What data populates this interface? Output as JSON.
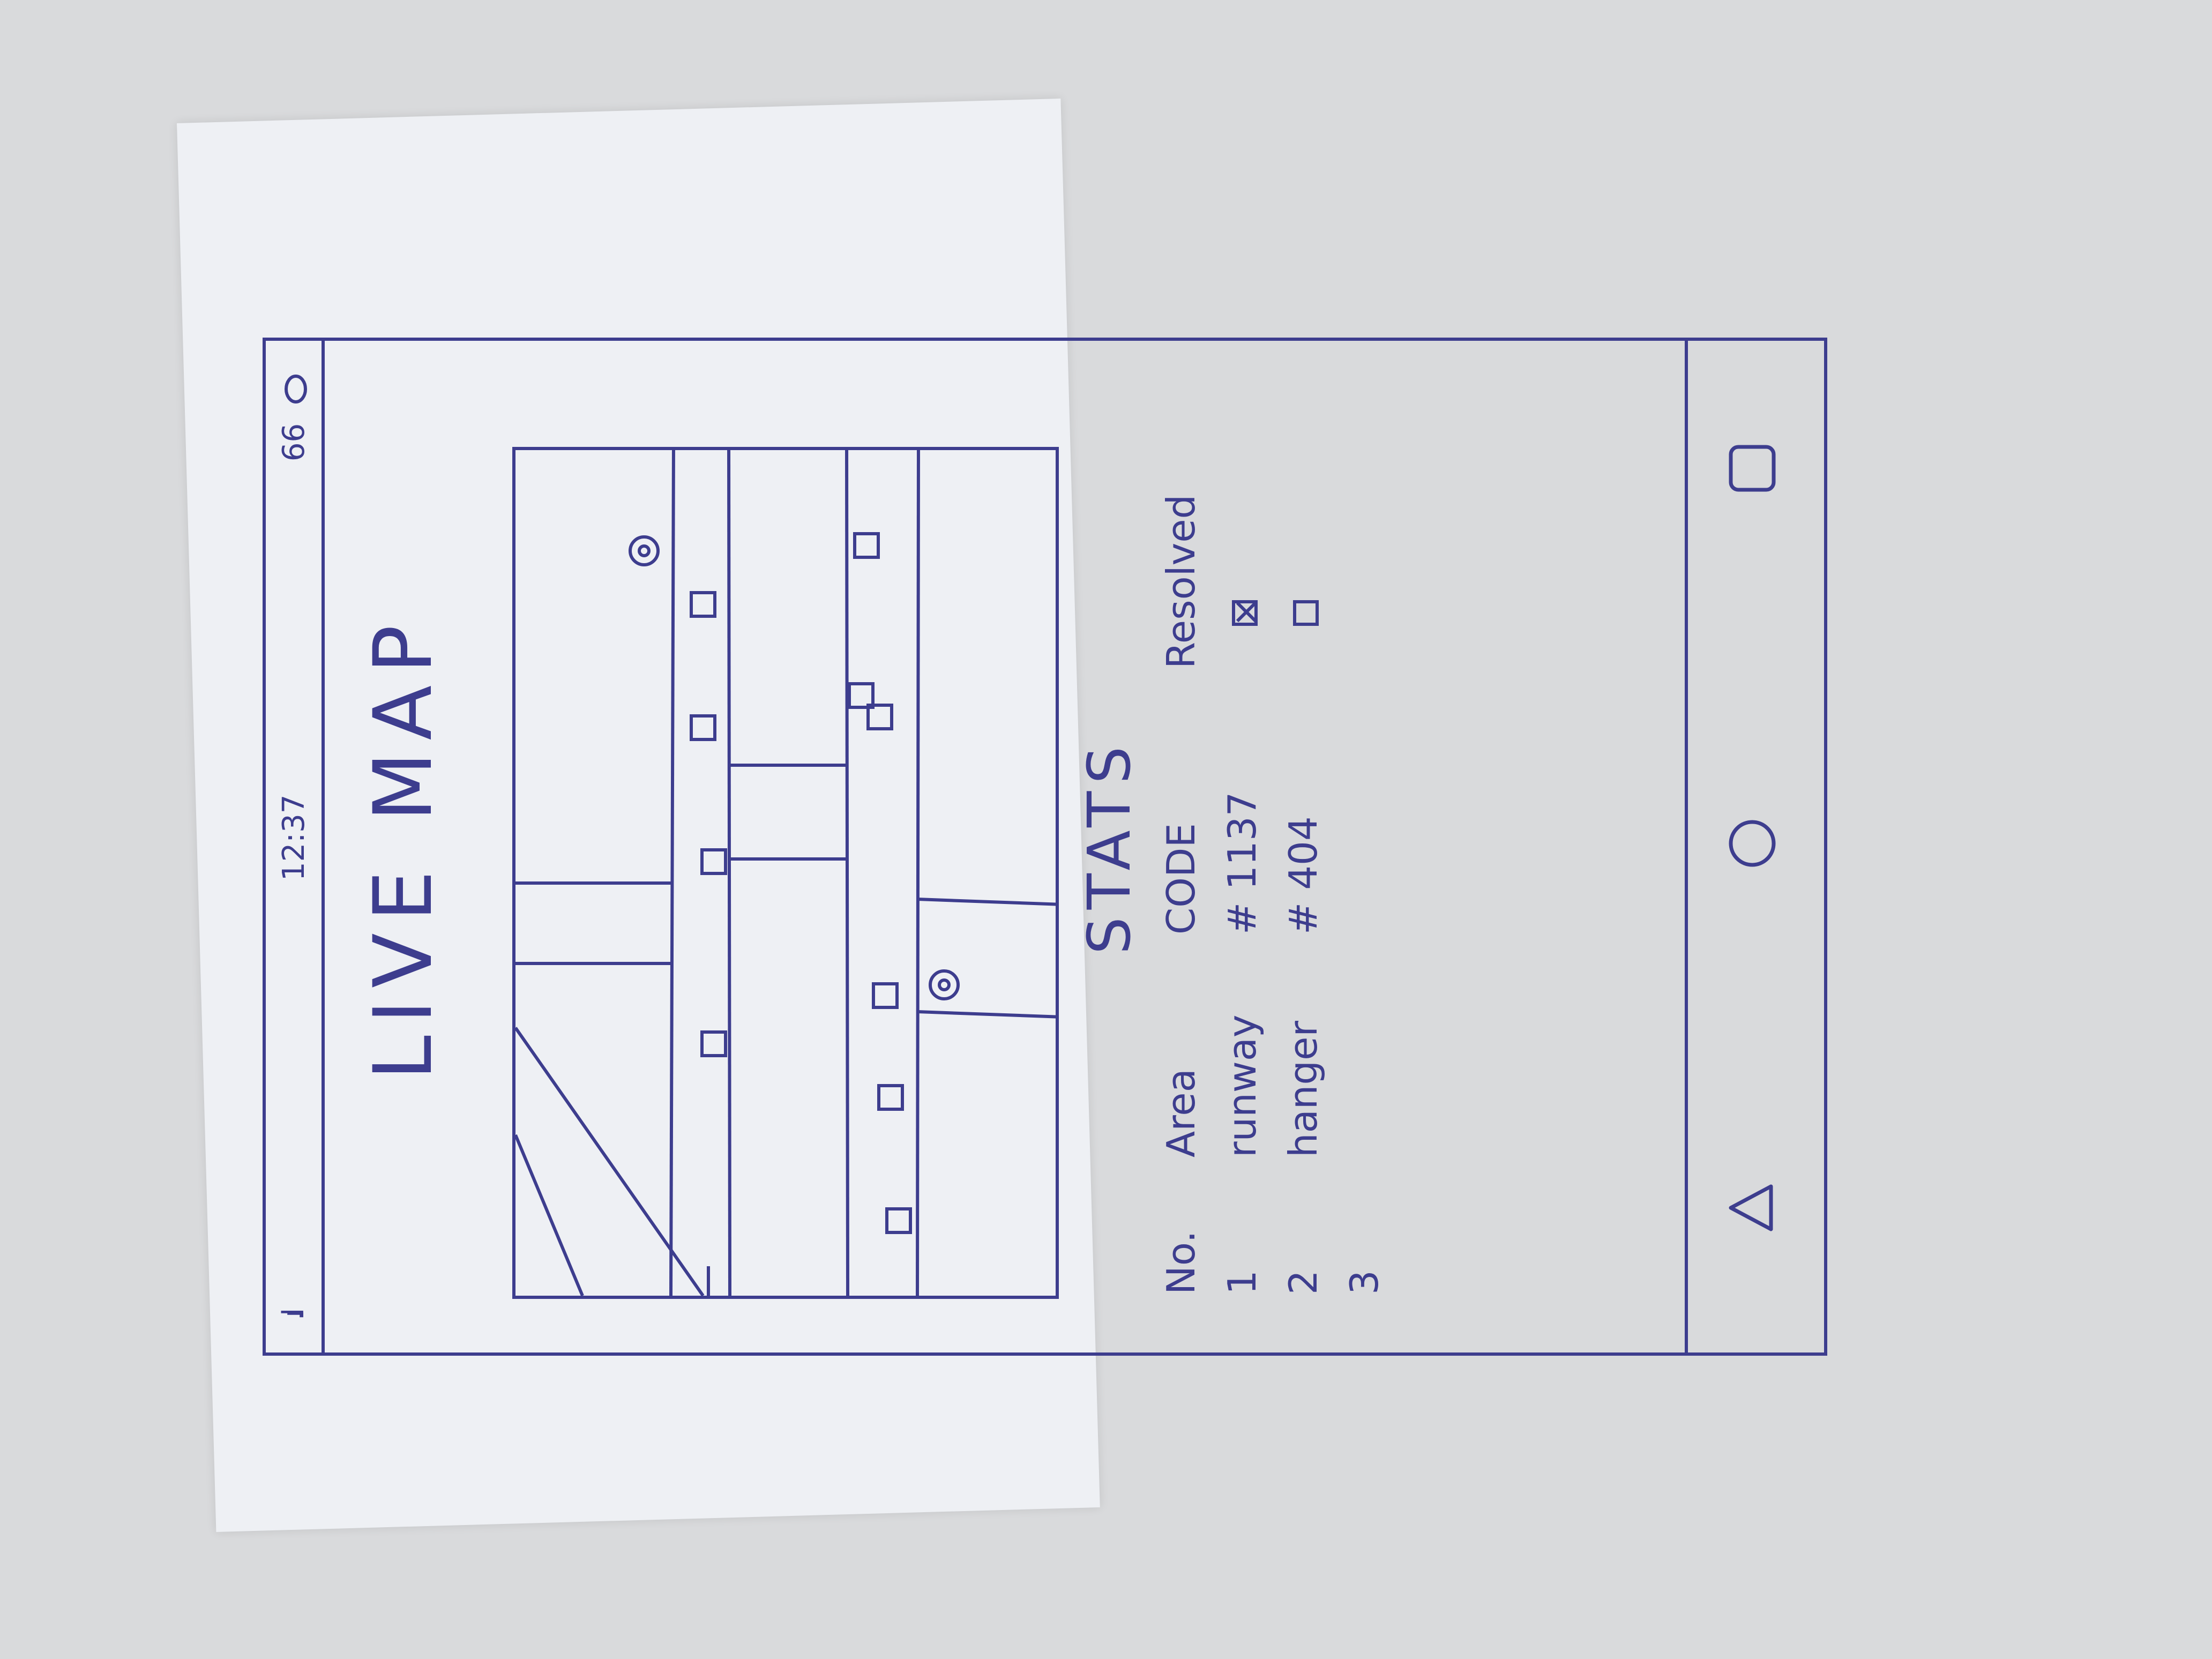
{
  "status_bar": {
    "signal": ".ıl",
    "time": "12:37",
    "battery": "66"
  },
  "header": {
    "title": "LIVE MAP"
  },
  "map": {
    "markers": [
      {
        "kind": "location-pin"
      },
      {
        "kind": "location-pin"
      },
      {
        "kind": "incident-box"
      },
      {
        "kind": "incident-box"
      },
      {
        "kind": "incident-box"
      },
      {
        "kind": "incident-box"
      },
      {
        "kind": "incident-box"
      },
      {
        "kind": "incident-box"
      },
      {
        "kind": "incident-box"
      },
      {
        "kind": "incident-box"
      },
      {
        "kind": "incident-box"
      },
      {
        "kind": "incident-box"
      }
    ]
  },
  "stats": {
    "title": "STATS",
    "columns": [
      "No.",
      "Area",
      "CODE",
      "Resolved"
    ],
    "rows": [
      {
        "no": "1",
        "area": "runway",
        "code": "# 1137",
        "resolved": true
      },
      {
        "no": "2",
        "area": "hanger",
        "code": "# 404",
        "resolved": false
      },
      {
        "no": "3",
        "area": "",
        "code": "",
        "resolved": null
      }
    ]
  },
  "nav": {
    "back": "back-icon",
    "home": "home-icon",
    "recent": "recent-apps-icon"
  },
  "colors": {
    "ink": "#3d3d8e",
    "paper": "#eef0f4",
    "background": "#d9dadc"
  }
}
